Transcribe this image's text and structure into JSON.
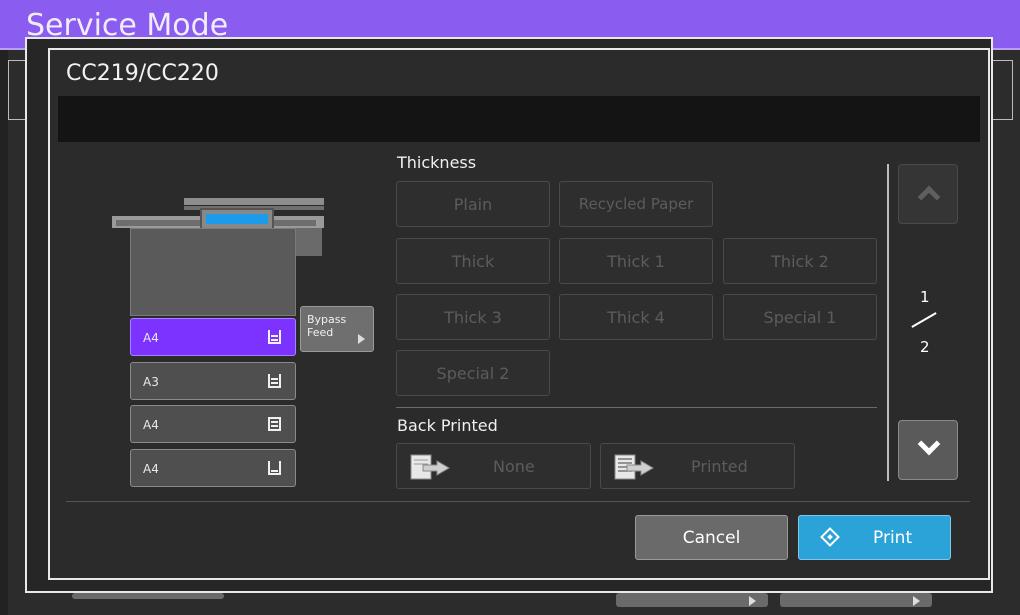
{
  "background": {
    "title": "Service Mode"
  },
  "dialog": {
    "title": "CC219/CC220",
    "message": "",
    "trays": [
      {
        "label": "A4",
        "selected": true
      },
      {
        "label": "A3",
        "selected": false
      },
      {
        "label": "A4",
        "selected": false
      },
      {
        "label": "A4",
        "selected": false
      }
    ],
    "bypass_label": "Bypass Feed",
    "thickness": {
      "label": "Thickness",
      "options": [
        "Plain",
        "Recycled Paper",
        "Thick",
        "Thick 1",
        "Thick 2",
        "Thick 3",
        "Thick 4",
        "Special 1",
        "Special 2"
      ]
    },
    "back_printed": {
      "label": "Back Printed",
      "options": [
        "None",
        "Printed"
      ]
    },
    "pagination": {
      "current": "1",
      "total": "2"
    },
    "cancel_label": "Cancel",
    "print_label": "Print"
  },
  "colors": {
    "header_purple": "#8a5cf0",
    "selected_tray": "#7d33ff",
    "print_blue": "#2ca3d8"
  }
}
